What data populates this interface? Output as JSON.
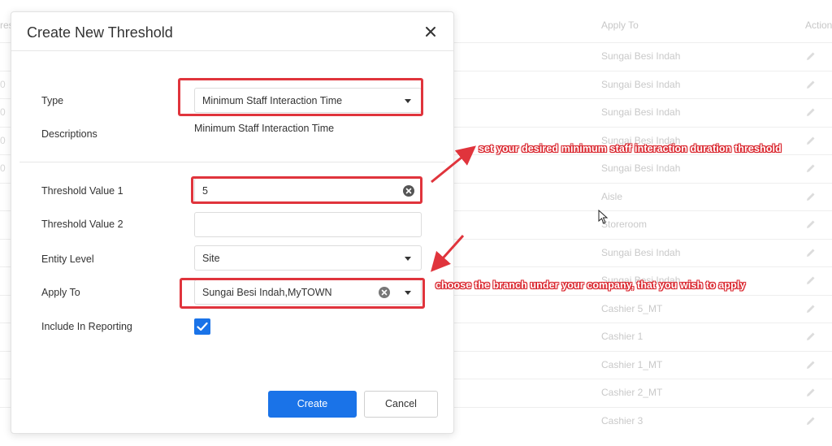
{
  "background": {
    "headers": {
      "left": "res",
      "apply_to": "Apply To",
      "actions": "Action"
    },
    "rows": [
      {
        "left": "",
        "apply_to": "Sungai Besi Indah"
      },
      {
        "left": "0",
        "apply_to": "Sungai Besi Indah"
      },
      {
        "left": "0",
        "apply_to": "Sungai Besi Indah"
      },
      {
        "left": "0",
        "apply_to": "Sungai Besi Indah"
      },
      {
        "left": "0",
        "apply_to": "Sungai Besi Indah"
      },
      {
        "left": "",
        "apply_to": "Aisle"
      },
      {
        "left": "",
        "apply_to": "Storeroom"
      },
      {
        "left": "",
        "apply_to": "Sungai Besi Indah"
      },
      {
        "left": "",
        "apply_to": "Sungai Besi Indah"
      },
      {
        "left": "",
        "apply_to": "Cashier 5_MT"
      },
      {
        "left": "",
        "apply_to": "Cashier 1"
      },
      {
        "left": "",
        "apply_to": "Cashier 1_MT"
      },
      {
        "left": "",
        "apply_to": "Cashier 2_MT"
      },
      {
        "left": "",
        "apply_to": "Cashier 3"
      }
    ]
  },
  "modal": {
    "title": "Create New Threshold",
    "close_icon": "close-icon",
    "fields": {
      "type": {
        "label": "Type",
        "value": "Minimum Staff Interaction Time"
      },
      "descriptions": {
        "label": "Descriptions",
        "value": "Minimum Staff Interaction Time"
      },
      "threshold_value_1": {
        "label": "Threshold Value 1",
        "value": "5"
      },
      "threshold_value_2": {
        "label": "Threshold Value 2",
        "value": ""
      },
      "entity_level": {
        "label": "Entity Level",
        "value": "Site"
      },
      "apply_to": {
        "label": "Apply To",
        "value": "Sungai Besi Indah,MyTOWN"
      },
      "include_in_reporting": {
        "label": "Include In Reporting",
        "checked": true
      }
    },
    "buttons": {
      "create": "Create",
      "cancel": "Cancel"
    }
  },
  "annotations": {
    "threshold_note": "set your desired minimum staff interaction duration threshold",
    "branch_note": "choose the branch under your company, that you wish to apply"
  },
  "colors": {
    "primary": "#1a73e8",
    "annotation_red": "#e0343c",
    "muted_text": "#c9c9c9"
  }
}
